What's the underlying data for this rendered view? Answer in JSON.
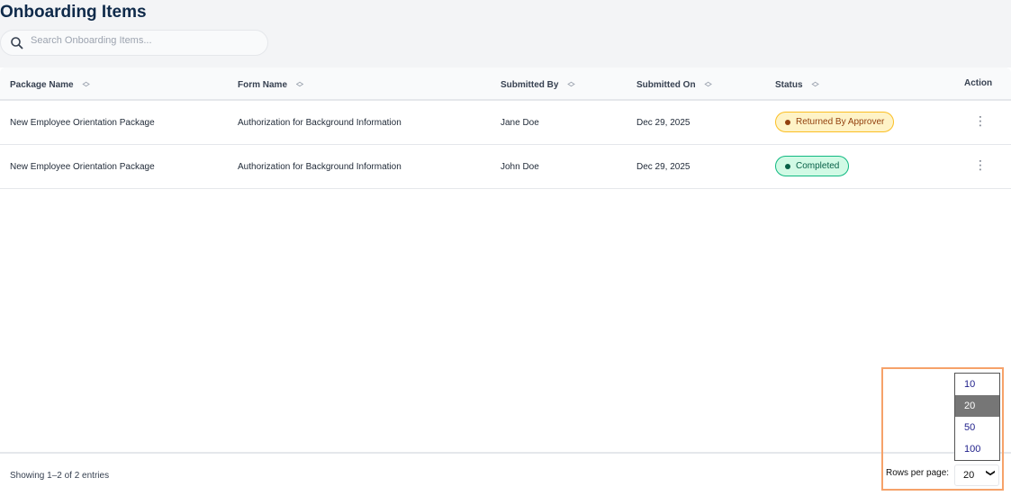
{
  "page": {
    "title": "Onboarding Items"
  },
  "search": {
    "placeholder": "Search Onboarding Items..."
  },
  "table": {
    "columns": [
      "Package Name",
      "Form Name",
      "Submitted By",
      "Submitted On",
      "Status",
      "Action"
    ],
    "rows": [
      {
        "package": "New Employee Orientation Package",
        "form": "Authorization for Background Information",
        "by": "Jane Doe",
        "on": "Dec 29, 2025",
        "status": "Returned By Approver"
      },
      {
        "package": "New Employee Orientation Package",
        "form": "Authorization for Background Information",
        "by": "John Doe",
        "on": "Dec 29, 2025",
        "status": "Completed"
      }
    ]
  },
  "colors": {
    "returned_bg": "#fef3c7",
    "returned_border": "#fbbf24",
    "returned_text": "#92400e",
    "completed_bg": "#d1fae5",
    "completed_border": "#10b981",
    "completed_text": "#065f46",
    "highlight": "#f6a26a"
  },
  "footer": {
    "showing": "Showing 1–2 of 2 entries",
    "rows_per_page_label": "Rows per page:",
    "rows_per_page_value": "20",
    "options": [
      "10",
      "20",
      "50",
      "100"
    ]
  }
}
